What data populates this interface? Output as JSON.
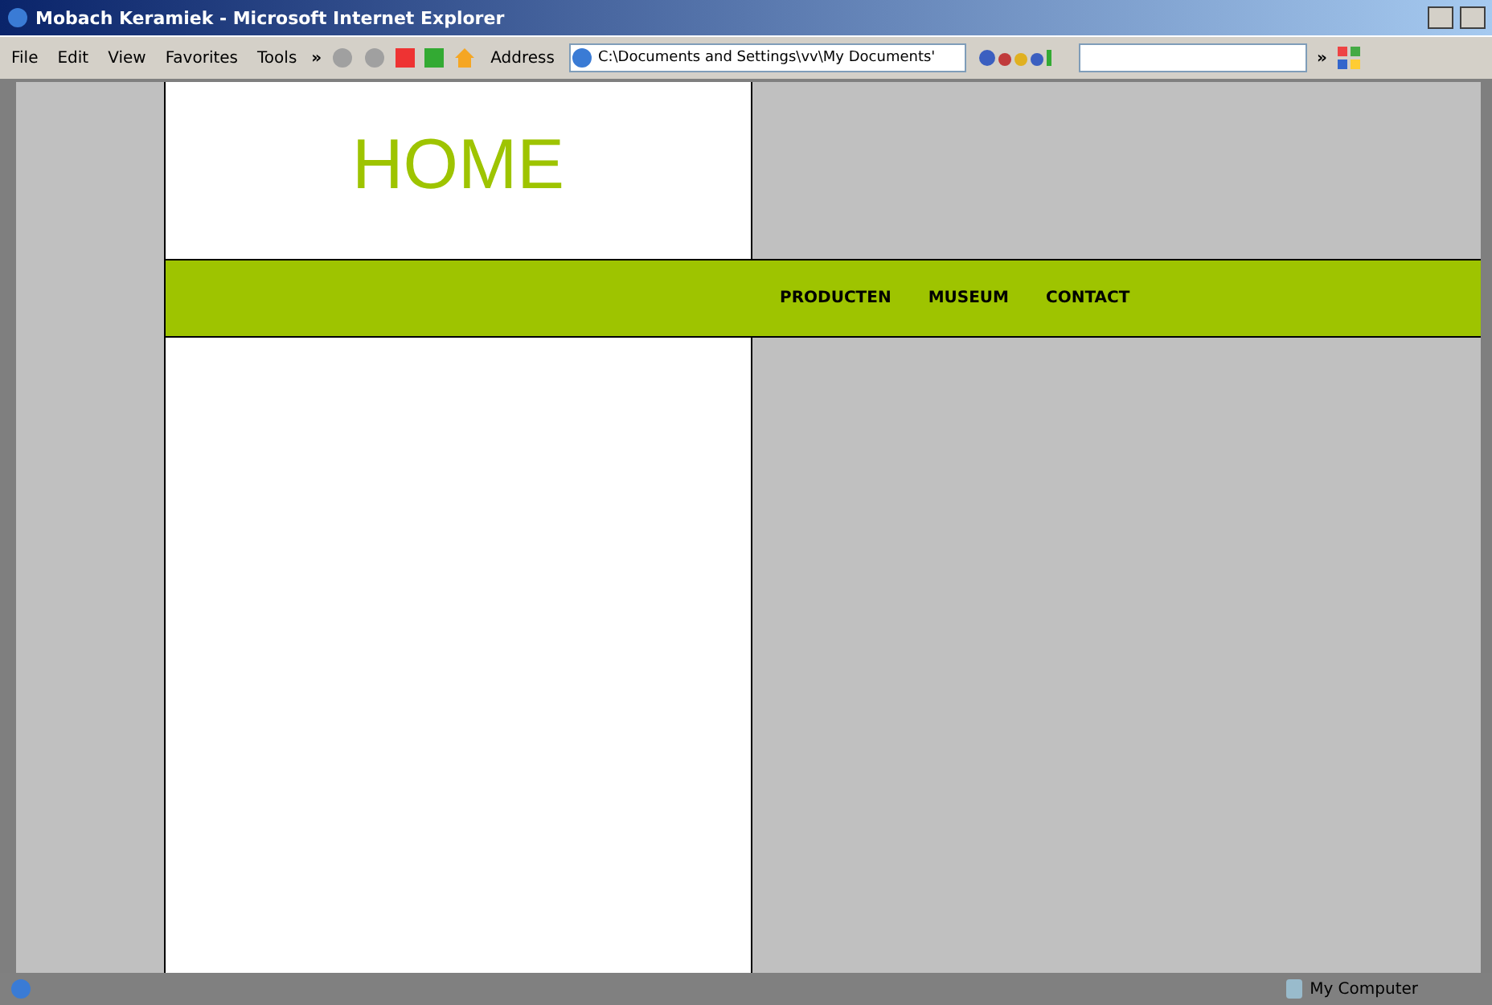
{
  "window": {
    "title": "Mobach Keramiek - Microsoft Internet Explorer"
  },
  "menu": [
    "File",
    "Edit",
    "View",
    "Favorites",
    "Tools"
  ],
  "toolbar": {
    "chevron": "»",
    "address_label": "Address",
    "address": "C:\\Documents and Settings\\vv\\My Documents'",
    "search_chevron": "»"
  },
  "page": {
    "heading": "HOME",
    "nav": [
      "PRODUCTEN",
      "MUSEUM",
      "CONTACT"
    ]
  },
  "status_bar": {
    "zone": "My Computer"
  }
}
